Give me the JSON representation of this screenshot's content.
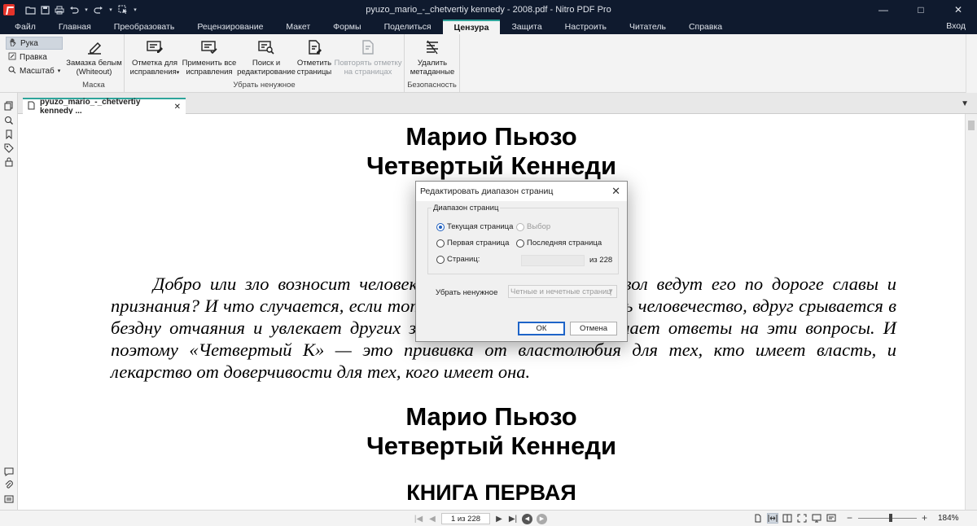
{
  "window": {
    "title": "pyuzo_mario_-_chetvertiy kennedy - 2008.pdf - Nitro PDF Pro",
    "minimize": "—",
    "maximize": "□",
    "close": "✕"
  },
  "menu": {
    "tabs": [
      "Файл",
      "Главная",
      "Преобразовать",
      "Рецензирование",
      "Макет",
      "Формы",
      "Поделиться",
      "Цензура",
      "Защита",
      "Настроить",
      "Читатель",
      "Справка"
    ],
    "active": "Цензура",
    "login": "Вход"
  },
  "ribbon": {
    "small_tools": {
      "hand": "Рука",
      "edit": "Правка",
      "zoom": "Масштаб"
    },
    "whiteout": {
      "line1": "Замазка белым",
      "line2": "(Whiteout)"
    },
    "mask_group": "Маска",
    "mark": {
      "line1": "Отметка для",
      "line2": "исправления"
    },
    "apply": {
      "line1": "Применить все",
      "line2": "исправления"
    },
    "search": {
      "line1": "Поиск и",
      "line2": "редактирование"
    },
    "mark_pages": {
      "line1": "Отметить",
      "line2": "страницы"
    },
    "repeat": {
      "line1": "Повторять отметку",
      "line2": "на страницах"
    },
    "remove_group": "Убрать ненужное",
    "delete_meta": {
      "line1": "Удалить",
      "line2": "метаданные"
    },
    "security_group": "Безопасность"
  },
  "doc_tab": {
    "label": "pyuzo_mario_-_chetvertiy kennedy ...",
    "close": "✕"
  },
  "document": {
    "title1_line1": "Марио Пьюзо",
    "title1_line2": "Четвертый Кеннеди",
    "para_line1": "Добро или зло возносит человека к власти? Бог или дьявол ведут его по дороге",
    "para_line2": "славы и признания? И что случается, если тот, кто хочет осчастливить человечество, вдруг",
    "para_line3": "срывается в бездну отчаяния и увлекает других за собой? Марио Пьюзо знает ответы на",
    "para_line4": "эти вопросы. И поэтому «Четвертый К» — это прививка от властолюбия для тех, кто имеет",
    "para_line5": "власть, и лекарство от доверчивости для тех, кого имеет она.",
    "title2_line1": "Марио Пьюзо",
    "title2_line2": "Четвертый Кеннеди",
    "book_title": "КНИГА ПЕРВАЯ"
  },
  "dialog": {
    "title": "Редактировать диапазон страниц",
    "close": "✕",
    "group_label": "Диапазон страниц",
    "current_page": "Текущая страница",
    "selection": "Выбор",
    "first_page": "Первая страница",
    "last_page": "Последняя страница",
    "pages": "Страниц:",
    "of_total": "из 228",
    "remove_label": "Убрать ненужное",
    "remove_value": "Четные и нечетные страниц",
    "ok": "ОК",
    "cancel": "Отмена"
  },
  "statusbar": {
    "page_indicator": "1 из 228",
    "zoom": "184%"
  }
}
